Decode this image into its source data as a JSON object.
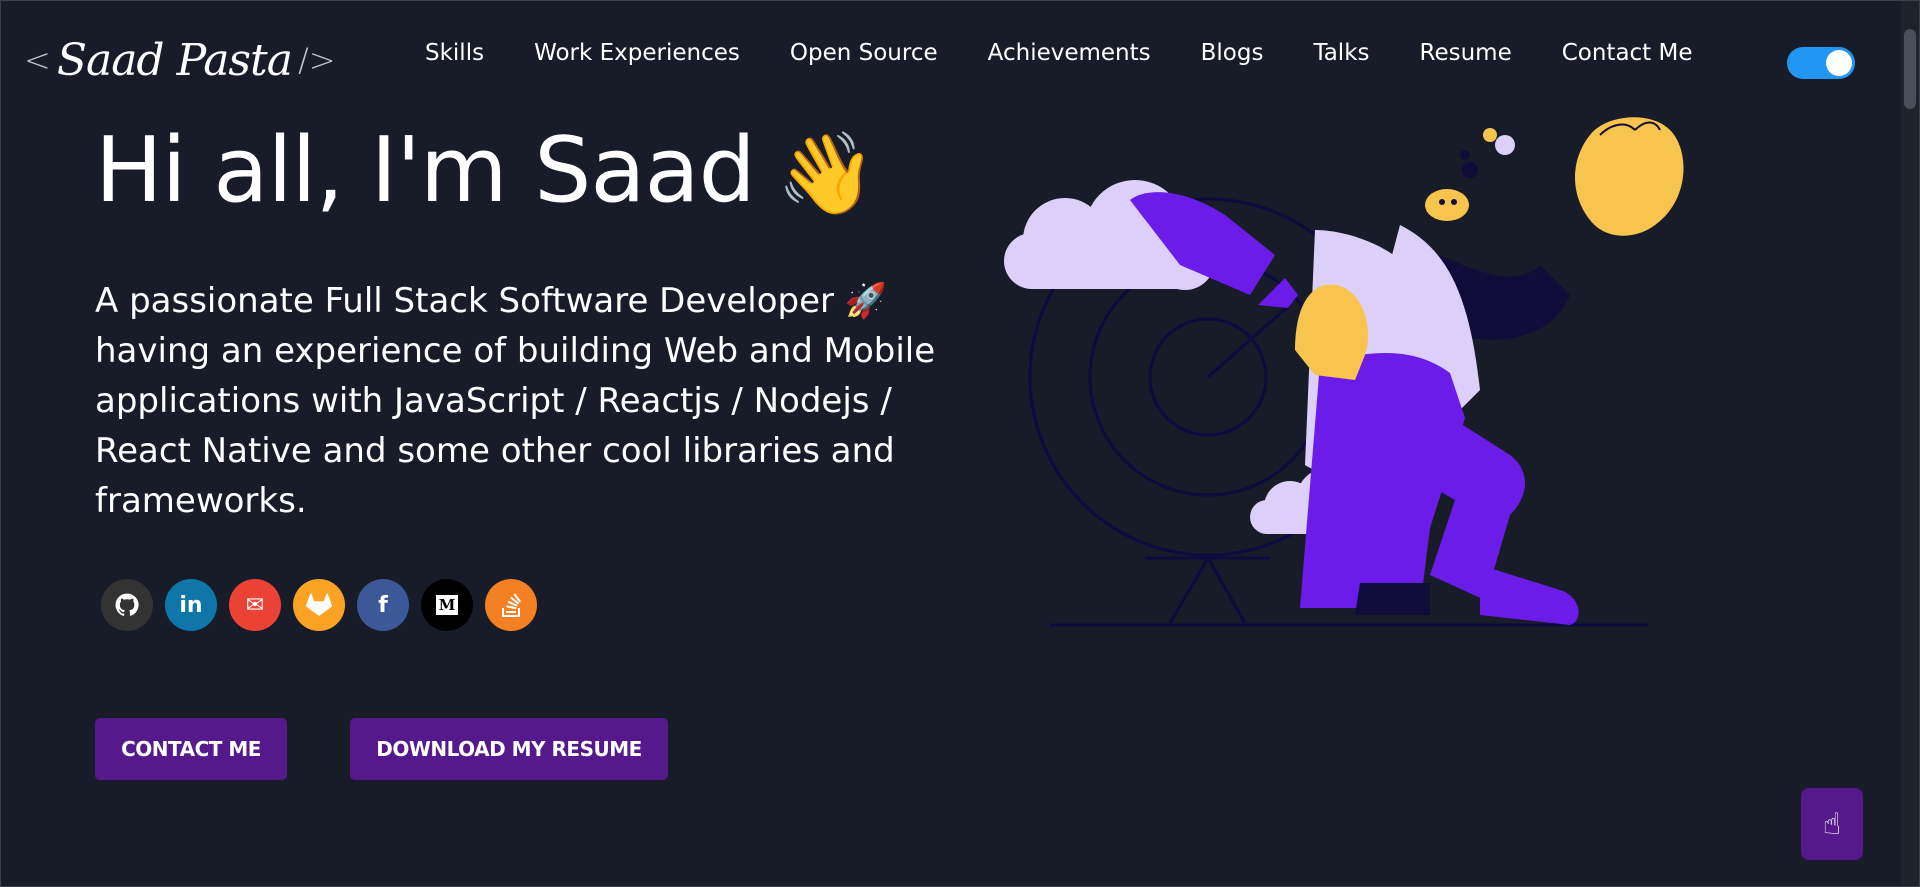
{
  "header": {
    "logo_open": "<",
    "logo_name": "Saad Pasta",
    "logo_close": "/>",
    "nav": [
      "Skills",
      "Work Experiences",
      "Open Source",
      "Achievements",
      "Blogs",
      "Talks",
      "Resume",
      "Contact Me"
    ],
    "theme_toggle_icon": "moon-icon"
  },
  "hero": {
    "greeting": "Hi all, I'm Saad",
    "greeting_emoji": "👋",
    "subtitle": "A passionate Full Stack Software Developer 🚀 having an experience of building Web and Mobile applications with JavaScript / Reactjs / Nodejs / React Native and some other cool libraries and frameworks.",
    "socials": [
      {
        "name": "github-icon",
        "glyph": "◕",
        "color": "#333333"
      },
      {
        "name": "linkedin-icon",
        "glyph": "in",
        "color": "#0e76a8"
      },
      {
        "name": "mail-icon",
        "glyph": "✉",
        "color": "#ea4335"
      },
      {
        "name": "gitlab-icon",
        "glyph": "◆",
        "color": "#fca326"
      },
      {
        "name": "facebook-icon",
        "glyph": "f",
        "color": "#3b5998"
      },
      {
        "name": "medium-icon",
        "glyph": "M",
        "color": "#000000"
      },
      {
        "name": "stackoverflow-icon",
        "glyph": "≡",
        "color": "#f48024"
      }
    ],
    "contact_button": "CONTACT ME",
    "resume_button": "DOWNLOAD MY RESUME"
  },
  "colors": {
    "background": "#171c28",
    "accent": "#55198b",
    "toggle": "#2196f3",
    "figure_purple": "#6c1ce8",
    "figure_lilac": "#dcd0fb",
    "figure_yellow": "#f7c44e"
  },
  "scroll_to_top_icon": "pointing-hand-icon"
}
